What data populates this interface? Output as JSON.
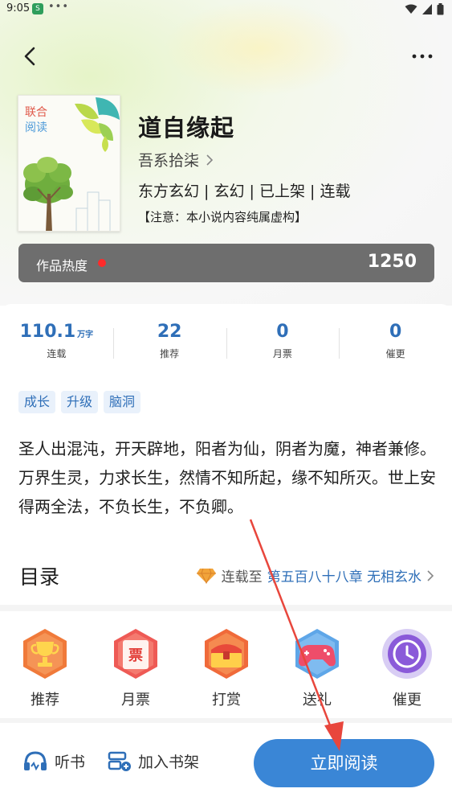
{
  "status_bar": {
    "time": "9:05",
    "app_badge": "S",
    "overflow_dots": "•••"
  },
  "nav": {
    "back_icon": "chevron-left-icon",
    "more_icon": "more-horizontal-icon"
  },
  "book": {
    "cover_text_a": "联合",
    "cover_text_b": "阅读",
    "title": "道自缘起",
    "author": "吾系拾柒",
    "tags": "东方玄幻 | 玄幻 | 已上架 | 连载",
    "note": "【注意：本小说内容纯属虚构】"
  },
  "heat": {
    "label": "作品热度",
    "value": "1250"
  },
  "stats": [
    {
      "value": "110.1",
      "unit": "万字",
      "label": "连载"
    },
    {
      "value": "22",
      "unit": "",
      "label": "推荐"
    },
    {
      "value": "0",
      "unit": "",
      "label": "月票"
    },
    {
      "value": "0",
      "unit": "",
      "label": "催更"
    }
  ],
  "chips": [
    "成长",
    "升级",
    "脑洞"
  ],
  "intro": "圣人出混沌，开天辟地，阳者为仙，阴者为魔，神者兼修。万界生灵，力求长生，然情不知所起，缘不知所灭。世上安得两全法，不负长生，不负卿。",
  "catalog": {
    "title": "目录",
    "prefix": "连载至",
    "chapter": "第五百八十八章  无相玄水"
  },
  "actions": [
    {
      "label": "推荐",
      "icon": "trophy-icon"
    },
    {
      "label": "月票",
      "icon": "ticket-icon",
      "icon_text": "票"
    },
    {
      "label": "打赏",
      "icon": "treasure-chest-icon"
    },
    {
      "label": "送礼",
      "icon": "gamepad-icon"
    },
    {
      "label": "催更",
      "icon": "clock-icon"
    }
  ],
  "bottom_bar": {
    "listen": "听书",
    "shelf": "加入书架",
    "read": "立即阅读"
  },
  "colors": {
    "accent": "#3a86d6",
    "stat_blue": "#2f6fb8",
    "heat_bar": "#6e6e6e",
    "annotation_red": "#e8463c"
  }
}
